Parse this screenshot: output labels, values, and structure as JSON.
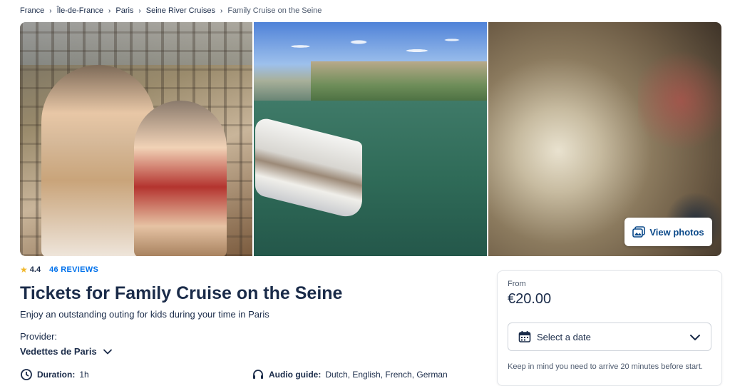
{
  "breadcrumb": [
    {
      "label": "France"
    },
    {
      "label": "Île-de-France"
    },
    {
      "label": "Paris"
    },
    {
      "label": "Seine River Cruises"
    },
    {
      "label": "Family Cruise on the Seine"
    }
  ],
  "gallery": {
    "view_photos_label": "View photos"
  },
  "rating": {
    "value": "4.4",
    "reviews_label": "46 REVIEWS"
  },
  "activity": {
    "title": "Tickets for Family Cruise on the Seine",
    "subtitle": "Enjoy an outstanding outing for kids during your time in Paris",
    "provider_label": "Provider:",
    "provider_name": "Vedettes de Paris"
  },
  "details": {
    "duration_label": "Duration:",
    "duration_value": "1h",
    "audio_label": "Audio guide:",
    "audio_value": "Dutch, English, French, German"
  },
  "booking": {
    "from_label": "From",
    "price": "€20.00",
    "date_placeholder": "Select a date",
    "arrive_note": "Keep in mind you need to arrive 20 minutes before start."
  },
  "colors": {
    "accent": "#0071eb",
    "star": "#f1b82d",
    "text": "#1a2b49"
  }
}
